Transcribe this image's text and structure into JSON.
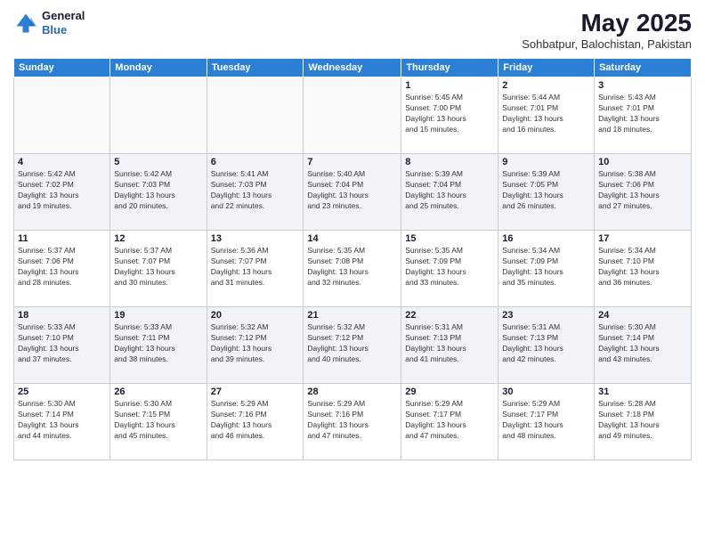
{
  "logo": {
    "line1": "General",
    "line2": "Blue"
  },
  "header": {
    "title": "May 2025",
    "subtitle": "Sohbatpur, Balochistan, Pakistan"
  },
  "days_of_week": [
    "Sunday",
    "Monday",
    "Tuesday",
    "Wednesday",
    "Thursday",
    "Friday",
    "Saturday"
  ],
  "weeks": [
    [
      {
        "num": "",
        "info": ""
      },
      {
        "num": "",
        "info": ""
      },
      {
        "num": "",
        "info": ""
      },
      {
        "num": "",
        "info": ""
      },
      {
        "num": "1",
        "info": "Sunrise: 5:45 AM\nSunset: 7:00 PM\nDaylight: 13 hours\nand 15 minutes."
      },
      {
        "num": "2",
        "info": "Sunrise: 5:44 AM\nSunset: 7:01 PM\nDaylight: 13 hours\nand 16 minutes."
      },
      {
        "num": "3",
        "info": "Sunrise: 5:43 AM\nSunset: 7:01 PM\nDaylight: 13 hours\nand 18 minutes."
      }
    ],
    [
      {
        "num": "4",
        "info": "Sunrise: 5:42 AM\nSunset: 7:02 PM\nDaylight: 13 hours\nand 19 minutes."
      },
      {
        "num": "5",
        "info": "Sunrise: 5:42 AM\nSunset: 7:03 PM\nDaylight: 13 hours\nand 20 minutes."
      },
      {
        "num": "6",
        "info": "Sunrise: 5:41 AM\nSunset: 7:03 PM\nDaylight: 13 hours\nand 22 minutes."
      },
      {
        "num": "7",
        "info": "Sunrise: 5:40 AM\nSunset: 7:04 PM\nDaylight: 13 hours\nand 23 minutes."
      },
      {
        "num": "8",
        "info": "Sunrise: 5:39 AM\nSunset: 7:04 PM\nDaylight: 13 hours\nand 25 minutes."
      },
      {
        "num": "9",
        "info": "Sunrise: 5:39 AM\nSunset: 7:05 PM\nDaylight: 13 hours\nand 26 minutes."
      },
      {
        "num": "10",
        "info": "Sunrise: 5:38 AM\nSunset: 7:06 PM\nDaylight: 13 hours\nand 27 minutes."
      }
    ],
    [
      {
        "num": "11",
        "info": "Sunrise: 5:37 AM\nSunset: 7:06 PM\nDaylight: 13 hours\nand 28 minutes."
      },
      {
        "num": "12",
        "info": "Sunrise: 5:37 AM\nSunset: 7:07 PM\nDaylight: 13 hours\nand 30 minutes."
      },
      {
        "num": "13",
        "info": "Sunrise: 5:36 AM\nSunset: 7:07 PM\nDaylight: 13 hours\nand 31 minutes."
      },
      {
        "num": "14",
        "info": "Sunrise: 5:35 AM\nSunset: 7:08 PM\nDaylight: 13 hours\nand 32 minutes."
      },
      {
        "num": "15",
        "info": "Sunrise: 5:35 AM\nSunset: 7:09 PM\nDaylight: 13 hours\nand 33 minutes."
      },
      {
        "num": "16",
        "info": "Sunrise: 5:34 AM\nSunset: 7:09 PM\nDaylight: 13 hours\nand 35 minutes."
      },
      {
        "num": "17",
        "info": "Sunrise: 5:34 AM\nSunset: 7:10 PM\nDaylight: 13 hours\nand 36 minutes."
      }
    ],
    [
      {
        "num": "18",
        "info": "Sunrise: 5:33 AM\nSunset: 7:10 PM\nDaylight: 13 hours\nand 37 minutes."
      },
      {
        "num": "19",
        "info": "Sunrise: 5:33 AM\nSunset: 7:11 PM\nDaylight: 13 hours\nand 38 minutes."
      },
      {
        "num": "20",
        "info": "Sunrise: 5:32 AM\nSunset: 7:12 PM\nDaylight: 13 hours\nand 39 minutes."
      },
      {
        "num": "21",
        "info": "Sunrise: 5:32 AM\nSunset: 7:12 PM\nDaylight: 13 hours\nand 40 minutes."
      },
      {
        "num": "22",
        "info": "Sunrise: 5:31 AM\nSunset: 7:13 PM\nDaylight: 13 hours\nand 41 minutes."
      },
      {
        "num": "23",
        "info": "Sunrise: 5:31 AM\nSunset: 7:13 PM\nDaylight: 13 hours\nand 42 minutes."
      },
      {
        "num": "24",
        "info": "Sunrise: 5:30 AM\nSunset: 7:14 PM\nDaylight: 13 hours\nand 43 minutes."
      }
    ],
    [
      {
        "num": "25",
        "info": "Sunrise: 5:30 AM\nSunset: 7:14 PM\nDaylight: 13 hours\nand 44 minutes."
      },
      {
        "num": "26",
        "info": "Sunrise: 5:30 AM\nSunset: 7:15 PM\nDaylight: 13 hours\nand 45 minutes."
      },
      {
        "num": "27",
        "info": "Sunrise: 5:29 AM\nSunset: 7:16 PM\nDaylight: 13 hours\nand 46 minutes."
      },
      {
        "num": "28",
        "info": "Sunrise: 5:29 AM\nSunset: 7:16 PM\nDaylight: 13 hours\nand 47 minutes."
      },
      {
        "num": "29",
        "info": "Sunrise: 5:29 AM\nSunset: 7:17 PM\nDaylight: 13 hours\nand 47 minutes."
      },
      {
        "num": "30",
        "info": "Sunrise: 5:29 AM\nSunset: 7:17 PM\nDaylight: 13 hours\nand 48 minutes."
      },
      {
        "num": "31",
        "info": "Sunrise: 5:28 AM\nSunset: 7:18 PM\nDaylight: 13 hours\nand 49 minutes."
      }
    ]
  ]
}
